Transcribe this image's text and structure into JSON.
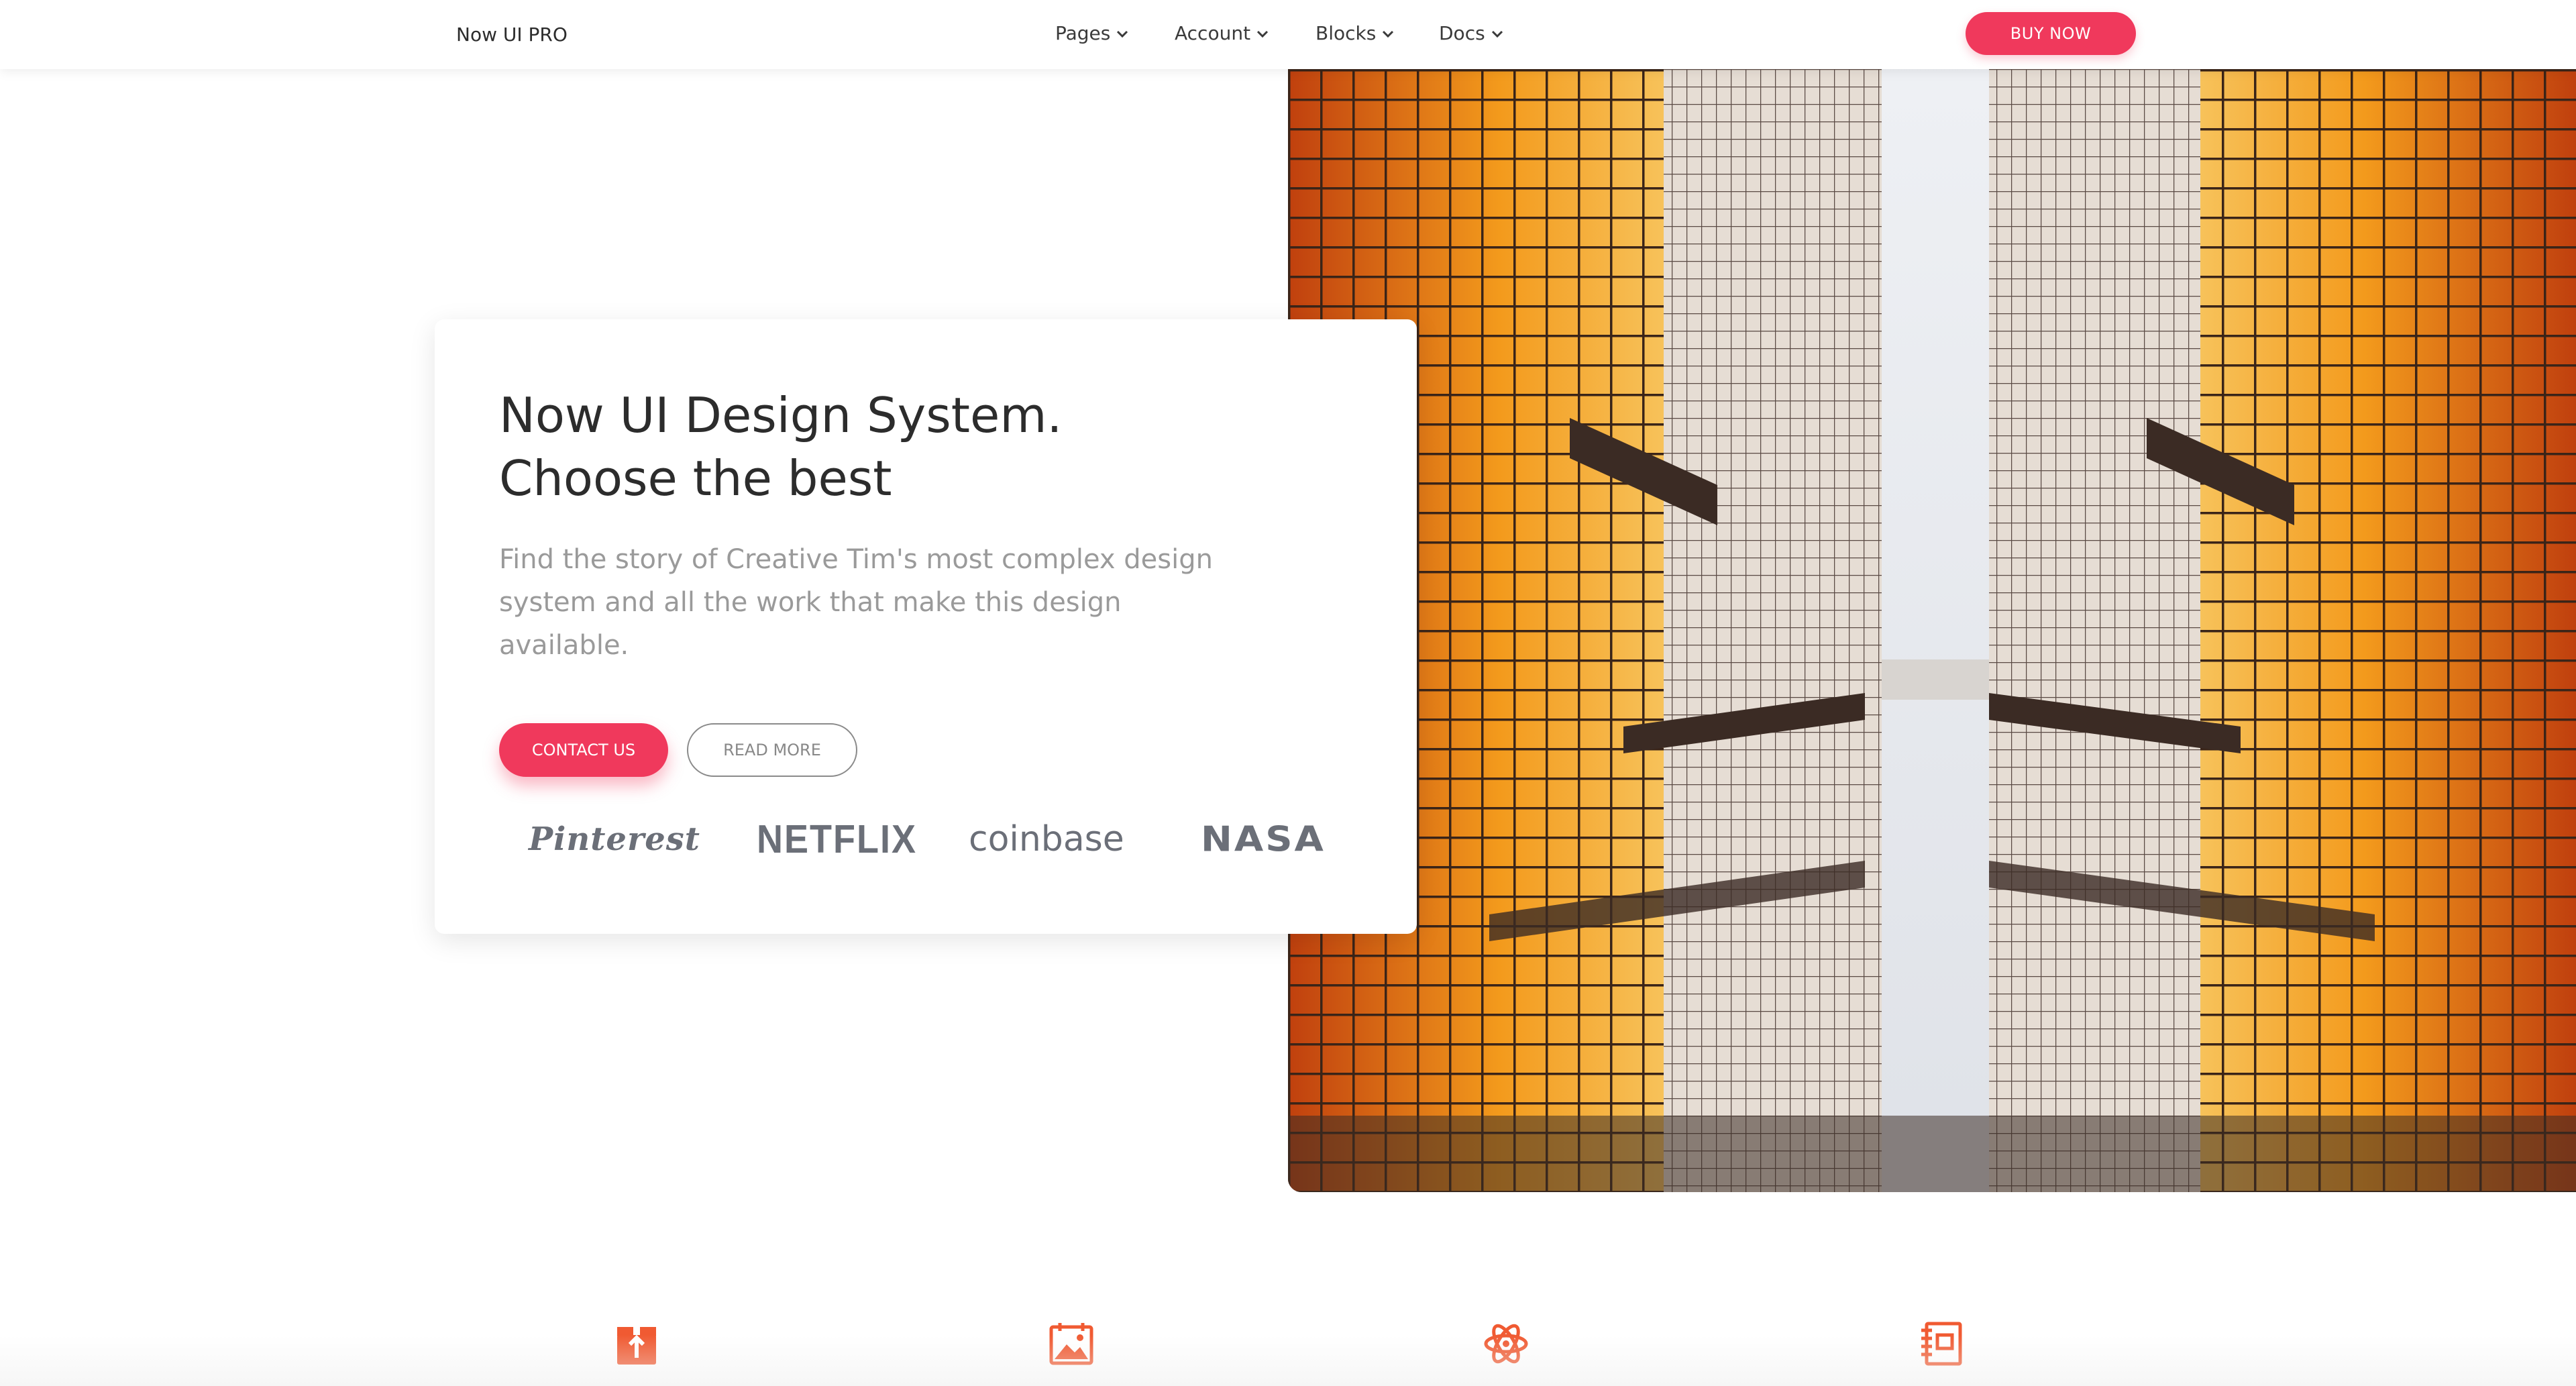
{
  "navbar": {
    "brand": "Now UI PRO",
    "items": [
      {
        "label": "Pages"
      },
      {
        "label": "Account"
      },
      {
        "label": "Blocks"
      },
      {
        "label": "Docs"
      }
    ],
    "buy_label": "BUY NOW"
  },
  "hero": {
    "title_line1": "Now UI Design System.",
    "title_line2": "Choose the best",
    "description": "Find the story of Creative Tim's most complex design system and all the work that make this design available.",
    "contact_label": "CONTACT US",
    "read_more_label": "READ MORE",
    "logos": [
      "Pinterest",
      "NETFLIX",
      "coinbase",
      "NASA"
    ]
  },
  "features": {
    "icons": [
      "box-upload-icon",
      "image-icon",
      "atom-icon",
      "notebook-icon"
    ]
  },
  "colors": {
    "accent": "#f0395c",
    "icon_orange": "#f05a32",
    "text_dark": "#2c2c2c",
    "text_muted": "#9a9a9a",
    "logo_gray": "#6b6f78"
  }
}
